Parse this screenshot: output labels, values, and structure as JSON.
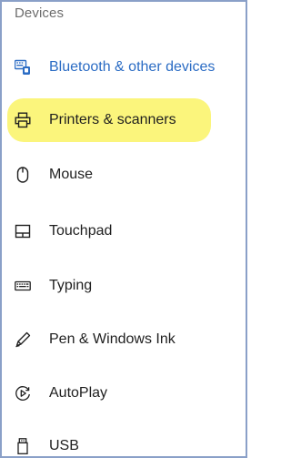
{
  "header": {
    "title": "Devices"
  },
  "nav": {
    "items": [
      {
        "label": "Bluetooth & other devices",
        "icon": "bluetooth-keyboard-icon",
        "active": true
      },
      {
        "label": "Printers & scanners",
        "icon": "printer-icon",
        "highlighted": true
      },
      {
        "label": "Mouse",
        "icon": "mouse-icon"
      },
      {
        "label": "Touchpad",
        "icon": "touchpad-icon"
      },
      {
        "label": "Typing",
        "icon": "keyboard-icon"
      },
      {
        "label": "Pen & Windows Ink",
        "icon": "pen-icon"
      },
      {
        "label": "AutoPlay",
        "icon": "autoplay-icon"
      },
      {
        "label": "USB",
        "icon": "usb-icon"
      }
    ]
  },
  "colors": {
    "accent": "#2b6cc4",
    "highlight": "#fbf57c",
    "border": "#8aa0c8"
  }
}
